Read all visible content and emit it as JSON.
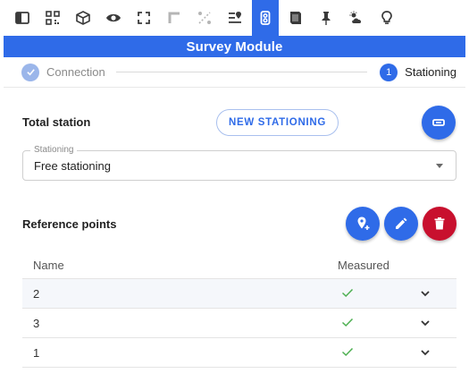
{
  "toolbar": {
    "icons": [
      "sidebar-panel-icon",
      "qr-code-icon",
      "cube-icon",
      "eye-icon",
      "fullscreen-icon",
      "crop-icon",
      "measure-icon",
      "layers-pin-icon",
      "survey-instrument-icon",
      "book-icon",
      "push-pin-icon",
      "weather-icon",
      "lightbulb-icon"
    ],
    "active": "survey-instrument-icon"
  },
  "header": {
    "title": "Survey Module"
  },
  "stepper": {
    "steps": [
      {
        "label": "Connection",
        "status": "done"
      },
      {
        "label": "Stationing",
        "number": "1",
        "status": "current"
      }
    ]
  },
  "total_station": {
    "title": "Total station",
    "new_button": "NEW STATIONING",
    "stationing_field": {
      "label": "Stationing",
      "value": "Free stationing"
    }
  },
  "reference_points": {
    "title": "Reference points",
    "columns": [
      "Name",
      "Measured"
    ],
    "rows": [
      {
        "name": "2",
        "measured": true
      },
      {
        "name": "3",
        "measured": true
      },
      {
        "name": "1",
        "measured": true
      }
    ]
  },
  "colors": {
    "accent": "#2f6be8",
    "danger": "#c8102e",
    "success": "#4caf50"
  }
}
